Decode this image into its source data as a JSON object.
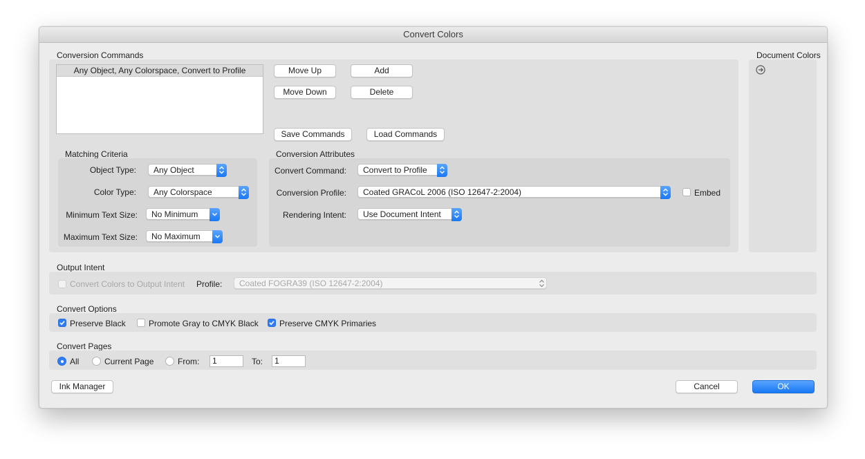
{
  "window": {
    "title": "Convert Colors"
  },
  "conversion_commands": {
    "heading": "Conversion Commands",
    "list": [
      "Any Object, Any Colorspace, Convert to Profile"
    ],
    "buttons": {
      "move_up": "Move Up",
      "add": "Add",
      "move_down": "Move Down",
      "delete": "Delete",
      "save": "Save Commands",
      "load": "Load Commands"
    }
  },
  "document_colors": {
    "heading": "Document Colors",
    "icon": "arrow-right-circle-icon"
  },
  "matching_criteria": {
    "heading": "Matching Criteria",
    "object_type": {
      "label": "Object Type:",
      "value": "Any Object"
    },
    "color_type": {
      "label": "Color Type:",
      "value": "Any Colorspace"
    },
    "min_text": {
      "label": "Minimum Text Size:",
      "value": "No Minimum"
    },
    "max_text": {
      "label": "Maximum Text Size:",
      "value": "No Maximum"
    }
  },
  "conversion_attributes": {
    "heading": "Conversion Attributes",
    "command": {
      "label": "Convert Command:",
      "value": "Convert to Profile"
    },
    "profile": {
      "label": "Conversion Profile:",
      "value": "Coated GRACoL 2006 (ISO 12647-2:2004)"
    },
    "embed": {
      "label": "Embed",
      "checked": false
    },
    "intent": {
      "label": "Rendering Intent:",
      "value": "Use Document Intent"
    }
  },
  "output_intent": {
    "heading": "Output Intent",
    "convert_label": "Convert Colors to Output Intent",
    "convert_checked": false,
    "profile_label": "Profile:",
    "profile_value": "Coated FOGRA39 (ISO 12647-2:2004)"
  },
  "convert_options": {
    "heading": "Convert Options",
    "preserve_black": {
      "label": "Preserve Black",
      "checked": true
    },
    "promote_gray": {
      "label": "Promote Gray to CMYK Black",
      "checked": false
    },
    "preserve_cmyk": {
      "label": "Preserve CMYK Primaries",
      "checked": true
    }
  },
  "convert_pages": {
    "heading": "Convert Pages",
    "all": "All",
    "current": "Current Page",
    "from": "From:",
    "from_value": "1",
    "to": "To:",
    "to_value": "1",
    "selected": "All"
  },
  "footer": {
    "ink_manager": "Ink Manager",
    "cancel": "Cancel",
    "ok": "OK"
  },
  "colors": {
    "accent": "#1878f3",
    "window_bg": "#ececec",
    "panel_bg": "#e0e0e0"
  }
}
